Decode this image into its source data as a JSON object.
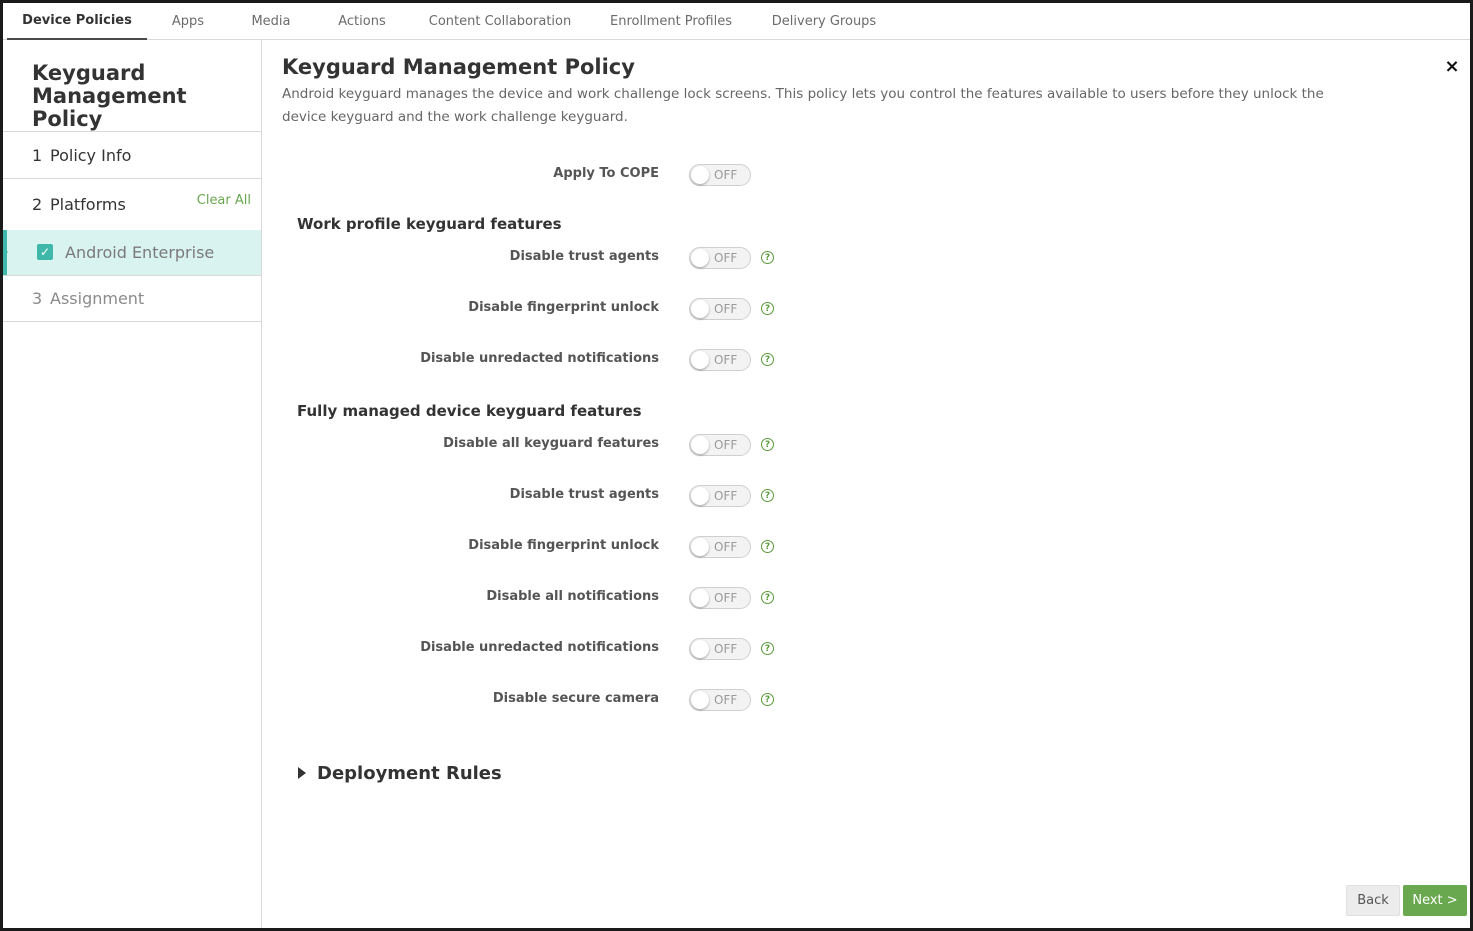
{
  "top_tabs": [
    {
      "label": "Device Policies",
      "active": true
    },
    {
      "label": "Apps",
      "active": false
    },
    {
      "label": "Media",
      "active": false
    },
    {
      "label": "Actions",
      "active": false
    },
    {
      "label": "Content Collaboration",
      "active": false
    },
    {
      "label": "Enrollment Profiles",
      "active": false
    },
    {
      "label": "Delivery Groups",
      "active": false
    }
  ],
  "sidebar": {
    "title": "Keyguard Management Policy",
    "steps": [
      {
        "num": "1",
        "label": "Policy Info"
      },
      {
        "num": "2",
        "label": "Platforms"
      },
      {
        "num": "3",
        "label": "Assignment"
      }
    ],
    "clear_all": "Clear All",
    "platform": {
      "label": "Android Enterprise",
      "checked": true,
      "check_glyph": "✓"
    }
  },
  "main": {
    "title": "Keyguard Management Policy",
    "close_glyph": "×",
    "description": "Android keyguard manages the device and work challenge lock screens. This policy lets you control the features available to users before they unlock the device keyguard and the work challenge keyguard.",
    "apply_cope": {
      "label": "Apply To COPE",
      "state": "OFF"
    },
    "work_profile": {
      "heading": "Work profile keyguard features",
      "rows": [
        {
          "label": "Disable trust agents",
          "state": "OFF"
        },
        {
          "label": "Disable fingerprint unlock",
          "state": "OFF"
        },
        {
          "label": "Disable unredacted notifications",
          "state": "OFF"
        }
      ]
    },
    "fully_managed": {
      "heading": "Fully managed device keyguard features",
      "rows": [
        {
          "label": "Disable all keyguard features",
          "state": "OFF"
        },
        {
          "label": "Disable trust agents",
          "state": "OFF"
        },
        {
          "label": "Disable fingerprint unlock",
          "state": "OFF"
        },
        {
          "label": "Disable all notifications",
          "state": "OFF"
        },
        {
          "label": "Disable unredacted notifications",
          "state": "OFF"
        },
        {
          "label": "Disable secure camera",
          "state": "OFF"
        }
      ]
    },
    "help_glyph": "?",
    "deployment_rules": "Deployment Rules"
  },
  "footer": {
    "back": "Back",
    "next": "Next >"
  },
  "colors": {
    "accent_green": "#6aa84f",
    "teal": "#3fb8aa",
    "selected_bg": "#d8f3f0"
  }
}
